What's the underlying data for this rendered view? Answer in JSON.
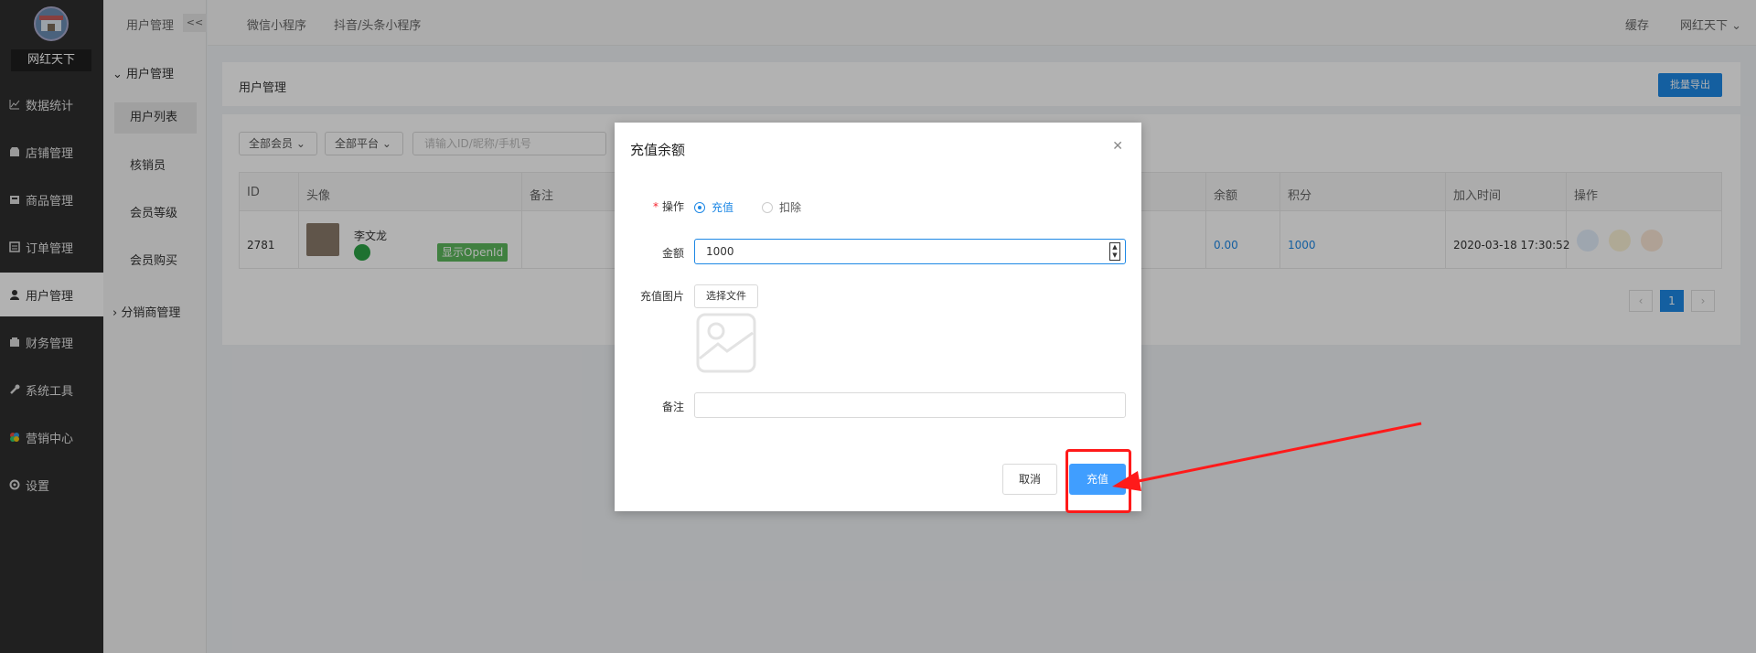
{
  "app": {
    "brand": "网红天下",
    "accent": "#1e88e5"
  },
  "sidebar": {
    "items": [
      {
        "label": "数据统计",
        "icon": "chart-line-icon"
      },
      {
        "label": "店铺管理",
        "icon": "store-icon"
      },
      {
        "label": "商品管理",
        "icon": "box-icon"
      },
      {
        "label": "订单管理",
        "icon": "order-icon"
      },
      {
        "label": "用户管理",
        "icon": "user-icon"
      },
      {
        "label": "财务管理",
        "icon": "finance-icon"
      },
      {
        "label": "系统工具",
        "icon": "wrench-icon"
      },
      {
        "label": "营销中心",
        "icon": "marketing-icon"
      },
      {
        "label": "设置",
        "icon": "gear-icon"
      }
    ]
  },
  "subnav": {
    "title": "用户管理",
    "collapse_label": "<<",
    "group1": "用户管理",
    "items": [
      "用户列表",
      "核销员",
      "会员等级",
      "会员购买"
    ],
    "group2": "分销商管理"
  },
  "topbar": {
    "tabs": [
      "微信小程序",
      "抖音/头条小程序"
    ],
    "cache": "缓存",
    "user": "网红天下"
  },
  "page": {
    "title": "用户管理",
    "export_label": "批量导出",
    "filters": {
      "member": "全部会员",
      "platform": "全部平台",
      "search_placeholder": "请输入ID/昵称/手机号"
    },
    "table": {
      "headers": [
        "ID",
        "头像",
        "备注",
        "余额",
        "积分",
        "加入时间",
        "操作"
      ],
      "row": {
        "id": "2781",
        "name": "李文龙",
        "openid_label": "显示OpenId",
        "balance": "0.00",
        "points": "1000",
        "joined": "2020-03-18 17:30:52"
      }
    },
    "pager": {
      "prev": "‹",
      "current": "1",
      "next": "›"
    }
  },
  "modal": {
    "title": "充值余额",
    "operation_label": "操作",
    "opt_recharge": "充值",
    "opt_deduct": "扣除",
    "amount_label": "金额",
    "amount_value": "1000",
    "image_label": "充值图片",
    "file_button": "选择文件",
    "remark_label": "备注",
    "cancel": "取消",
    "confirm": "充值"
  }
}
